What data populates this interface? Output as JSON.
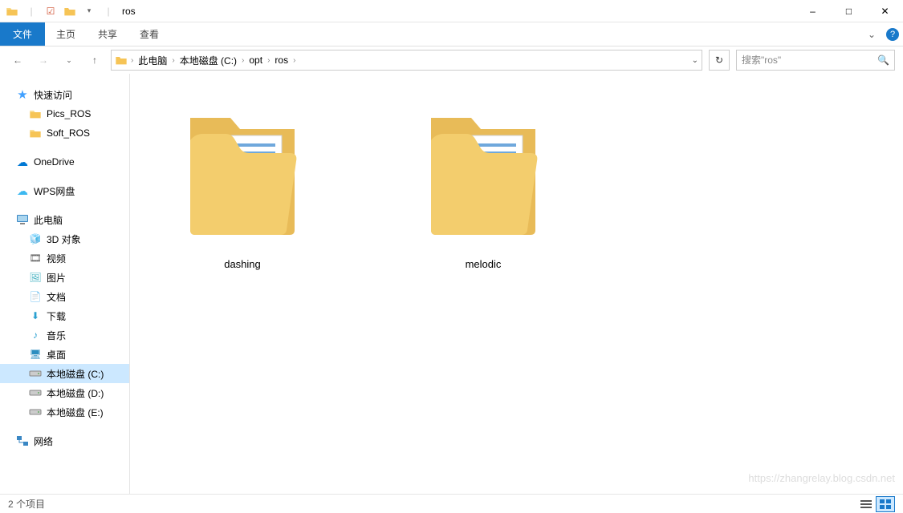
{
  "window": {
    "title": "ros",
    "qat": [
      "folder-icon",
      "properties-icon",
      "new-folder-icon"
    ],
    "controls": {
      "min": "–",
      "max": "□",
      "close": "✕"
    }
  },
  "ribbon": {
    "file": "文件",
    "tabs": [
      "主页",
      "共享",
      "查看"
    ],
    "expand_icon": "⌄",
    "help_icon": "?"
  },
  "nav": {
    "back": "←",
    "forward": "→",
    "recent": "⌄",
    "up": "↑",
    "crumbs": [
      "此电脑",
      "本地磁盘 (C:)",
      "opt",
      "ros"
    ],
    "refresh": "↻",
    "search_placeholder": "搜索\"ros\"",
    "search_icon": "🔍",
    "dropdown": "⌄"
  },
  "sidebar": {
    "groups": [
      {
        "top": {
          "label": "快速访问",
          "icon": "star",
          "color": "#40a0ff"
        },
        "children": [
          {
            "label": "Pics_ROS",
            "icon": "folder",
            "color": "#f6c456"
          },
          {
            "label": "Soft_ROS",
            "icon": "folder",
            "color": "#f6c456"
          }
        ]
      },
      {
        "top": {
          "label": "OneDrive",
          "icon": "cloud",
          "color": "#0078d4"
        },
        "children": []
      },
      {
        "top": {
          "label": "WPS网盘",
          "icon": "cloud",
          "color": "#3cb8f0"
        },
        "children": []
      },
      {
        "top": {
          "label": "此电脑",
          "icon": "pc",
          "color": "#3a87c4"
        },
        "children": [
          {
            "label": "3D 对象",
            "icon": "3d",
            "color": "#2aa0d0"
          },
          {
            "label": "视频",
            "icon": "video",
            "color": "#555"
          },
          {
            "label": "图片",
            "icon": "picture",
            "color": "#40b0c0"
          },
          {
            "label": "文档",
            "icon": "doc",
            "color": "#555"
          },
          {
            "label": "下载",
            "icon": "download",
            "color": "#2aa0d0"
          },
          {
            "label": "音乐",
            "icon": "music",
            "color": "#2aa0d0"
          },
          {
            "label": "桌面",
            "icon": "desktop",
            "color": "#2c8ec0"
          },
          {
            "label": "本地磁盘 (C:)",
            "icon": "drive",
            "color": "#888",
            "selected": true
          },
          {
            "label": "本地磁盘 (D:)",
            "icon": "drive",
            "color": "#888"
          },
          {
            "label": "本地磁盘 (E:)",
            "icon": "drive",
            "color": "#888"
          }
        ]
      },
      {
        "top": {
          "label": "网络",
          "icon": "network",
          "color": "#3a87c4"
        },
        "children": []
      }
    ]
  },
  "items": [
    {
      "name": "dashing"
    },
    {
      "name": "melodic"
    }
  ],
  "status": {
    "count": "2 个项目",
    "watermark": "https://zhangrelay.blog.csdn.net"
  }
}
